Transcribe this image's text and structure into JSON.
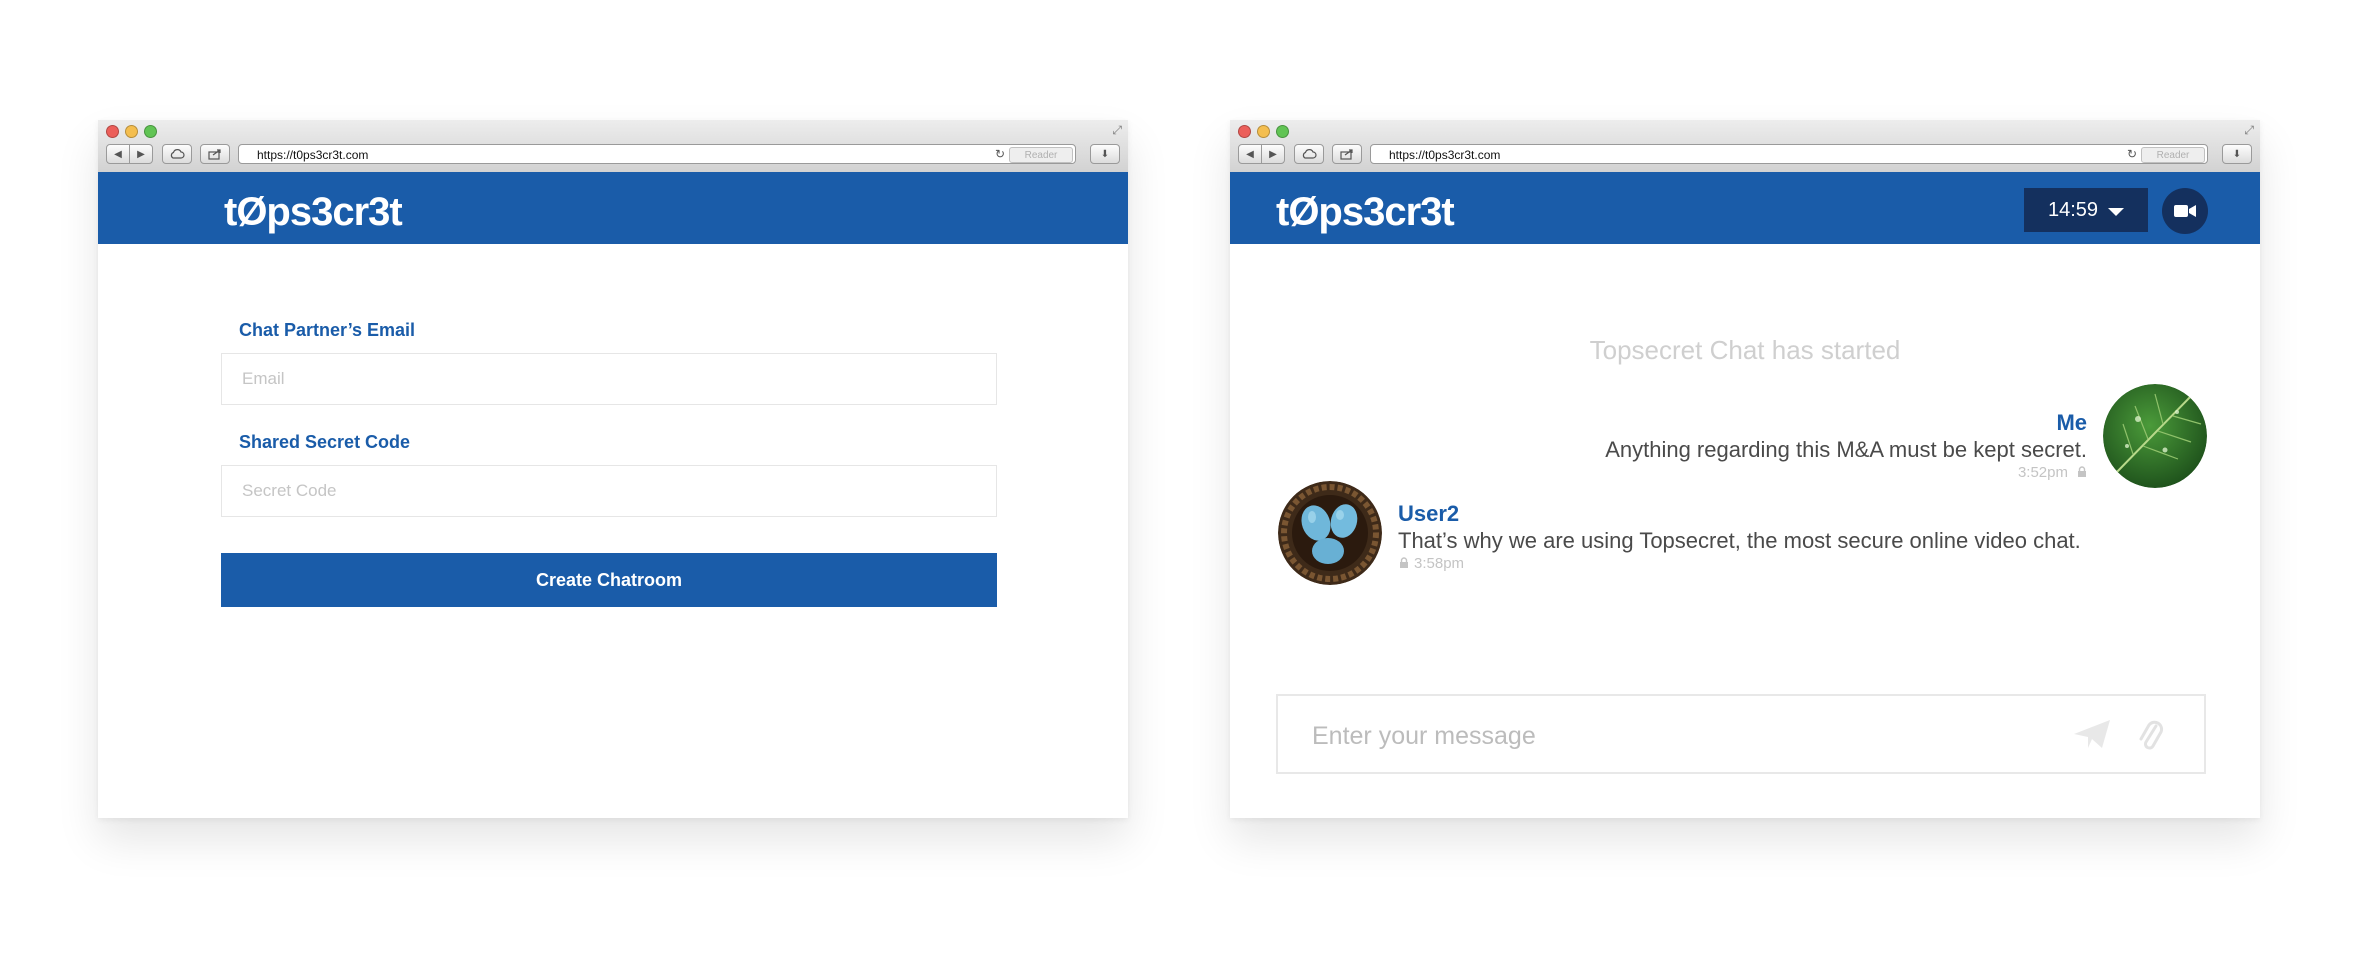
{
  "browser": {
    "url": "https://t0ps3cr3t.com",
    "reader_label": "Reader"
  },
  "app": {
    "logo": "tØps3cr3t"
  },
  "create_form": {
    "email_label": "Chat Partner’s Email",
    "email_placeholder": "Email",
    "code_label": "Shared Secret Code",
    "code_placeholder": "Secret Code",
    "submit_label": "Create Chatroom"
  },
  "chat": {
    "timer": "14:59",
    "started_text": "Topsecret Chat has started",
    "messages": [
      {
        "sender": "Me",
        "text": "Anything regarding this M&A must be kept secret.",
        "time": "3:52pm",
        "avatar": "leaf-avatar"
      },
      {
        "sender": "User2",
        "text": "That’s why we are using Topsecret, the most secure online video chat.",
        "time": "3:58pm",
        "avatar": "nest-eggs-avatar"
      }
    ],
    "composer_placeholder": "Enter your message"
  },
  "colors": {
    "brand_blue": "#1a5ca9",
    "dark_navy": "#14305e"
  },
  "icons": [
    "back-icon",
    "forward-icon",
    "cloud-icon",
    "share-icon",
    "reload-icon",
    "download-icon",
    "video-camera-icon",
    "caret-down-icon",
    "lock-icon",
    "send-icon",
    "paperclip-icon"
  ]
}
